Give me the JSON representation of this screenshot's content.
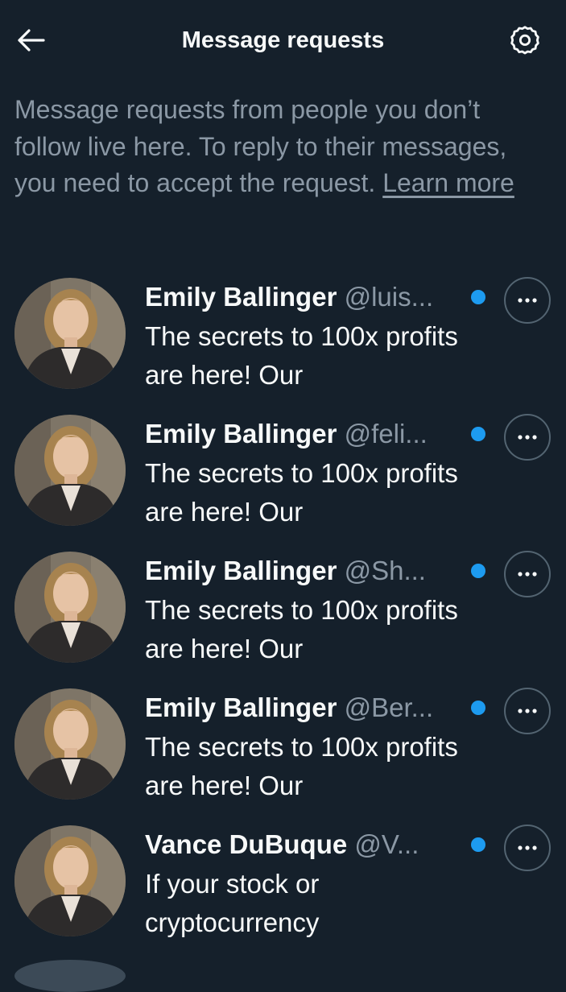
{
  "header": {
    "title": "Message requests",
    "back_icon": "arrow-left-icon",
    "settings_icon": "gear-icon"
  },
  "intro": {
    "text": "Message requests from people you don’t follow live here. To reply to their messages, you need to accept the request.",
    "learn_more": "Learn more"
  },
  "colors": {
    "background": "#15202b",
    "accent": "#1d9bf0",
    "muted": "#8b98a5",
    "text": "#f7f9f9"
  },
  "requests": [
    {
      "name": "Emily Ballinger",
      "handle": "@luis...",
      "preview": "The secrets to 100x profits are here! Our",
      "unread": true
    },
    {
      "name": "Emily Ballinger",
      "handle": "@feli...",
      "preview": "The secrets to 100x profits are here! Our",
      "unread": true
    },
    {
      "name": "Emily Ballinger",
      "handle": "@Sh...",
      "preview": "The secrets to 100x profits are here! Our",
      "unread": true
    },
    {
      "name": "Emily Ballinger",
      "handle": "@Ber...",
      "preview": "The secrets to 100x profits are here! Our",
      "unread": true
    },
    {
      "name": "Vance DuBuque",
      "handle": "@V...",
      "preview": "If your stock or cryptocurrency",
      "unread": true
    }
  ]
}
